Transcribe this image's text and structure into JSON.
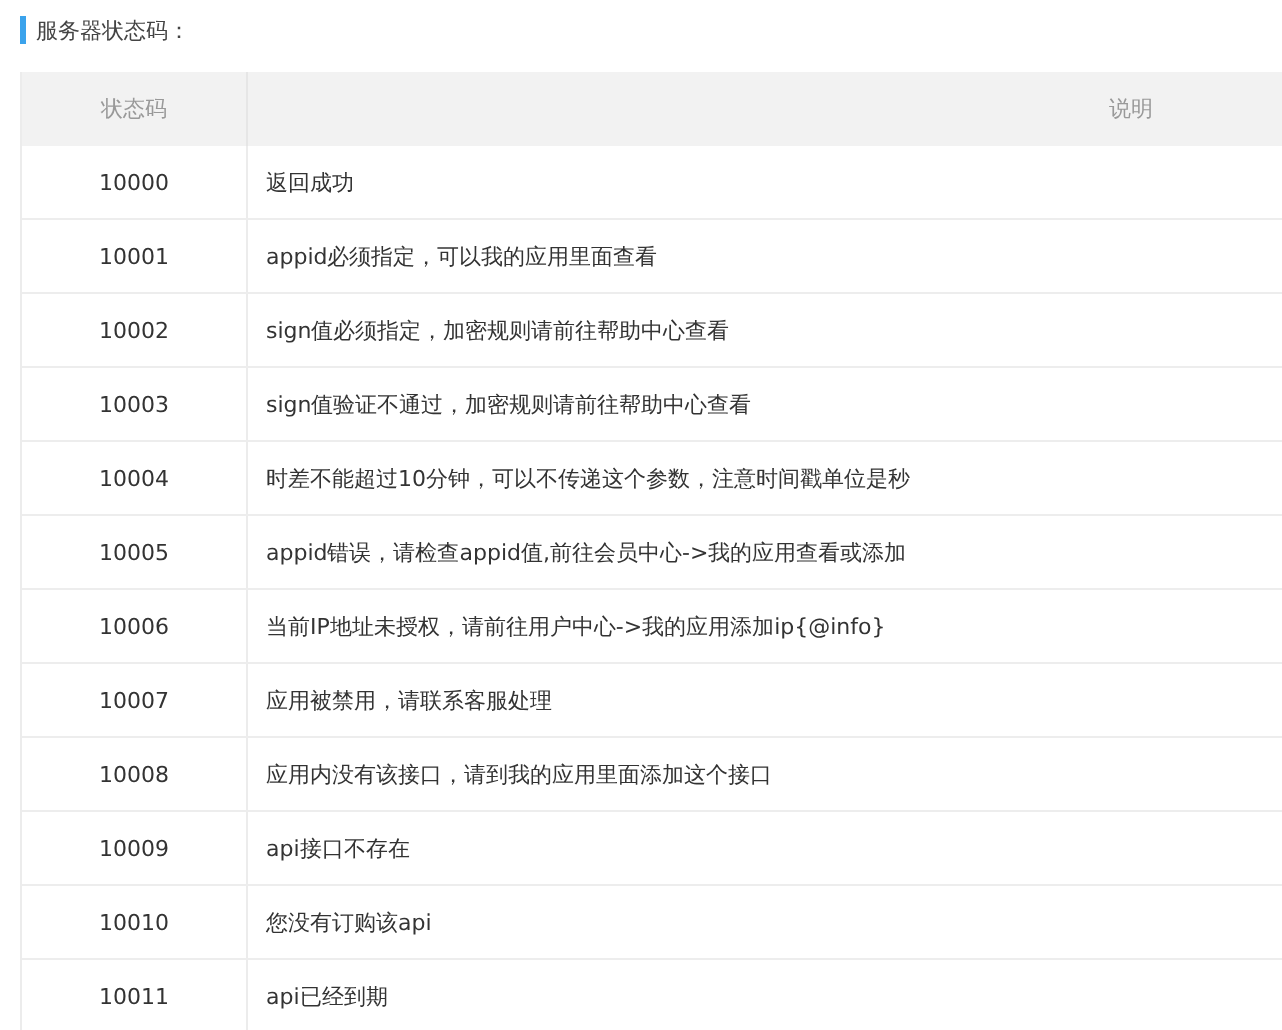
{
  "title": "服务器状态码：",
  "table": {
    "columns": [
      "状态码",
      "说明"
    ],
    "rows": [
      {
        "code": "10000",
        "description": "返回成功"
      },
      {
        "code": "10001",
        "description": "appid必须指定，可以我的应用里面查看"
      },
      {
        "code": "10002",
        "description": "sign值必须指定，加密规则请前往帮助中心查看"
      },
      {
        "code": "10003",
        "description": "sign值验证不通过，加密规则请前往帮助中心查看"
      },
      {
        "code": "10004",
        "description": "时差不能超过10分钟，可以不传递这个参数，注意时间戳单位是秒"
      },
      {
        "code": "10005",
        "description": "appid错误，请检查appid值,前往会员中心->我的应用查看或添加"
      },
      {
        "code": "10006",
        "description": "当前IP地址未授权，请前往用户中心->我的应用添加ip{@info}"
      },
      {
        "code": "10007",
        "description": "应用被禁用，请联系客服处理"
      },
      {
        "code": "10008",
        "description": "应用内没有该接口，请到我的应用里面添加这个接口"
      },
      {
        "code": "10009",
        "description": "api接口不存在"
      },
      {
        "code": "10010",
        "description": "您没有订购该api"
      },
      {
        "code": "10011",
        "description": "api已经到期"
      }
    ]
  }
}
